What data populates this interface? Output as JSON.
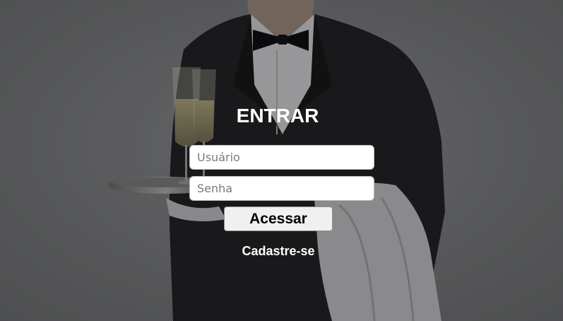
{
  "login": {
    "title": "ENTRAR",
    "username_placeholder": "Usuário",
    "password_placeholder": "Senha",
    "submit_label": "Acessar",
    "signup_label": "Cadastre-se"
  },
  "colors": {
    "background_overlay": "#6b6b6d",
    "title_text": "#ffffff",
    "button_background": "#f0f0f0"
  },
  "background": {
    "icon": "waiter-with-champagne-tray-photo"
  }
}
